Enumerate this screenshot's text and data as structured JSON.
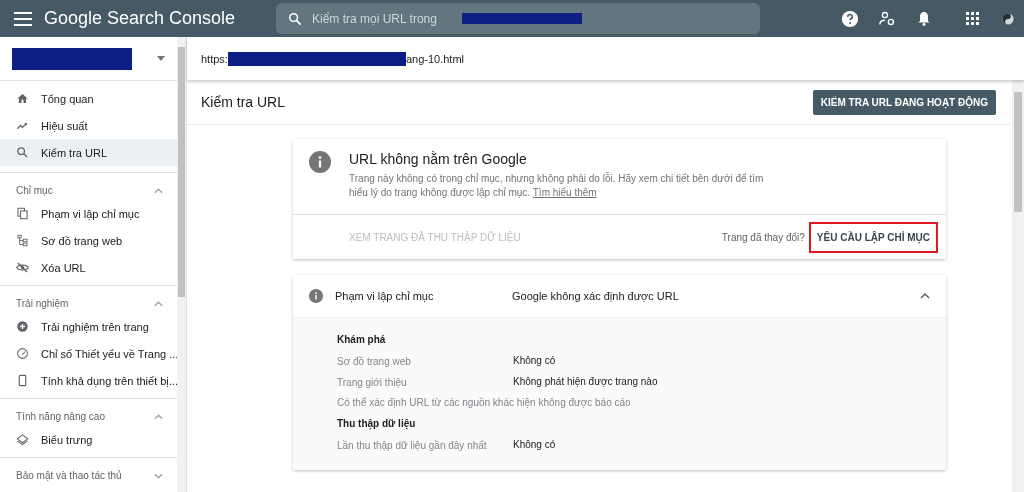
{
  "topbar": {
    "app_title": "Google Search Console",
    "search": {
      "placeholder": "Kiểm tra mọi URL trong"
    }
  },
  "url_bar": {
    "prefix": "https:",
    "suffix": "ang-10.html"
  },
  "sidebar": {
    "sections": [
      {
        "items": [
          {
            "label": "Tổng quan",
            "selected": false
          },
          {
            "label": "Hiệu suất",
            "selected": false
          },
          {
            "label": "Kiểm tra URL",
            "selected": true
          }
        ]
      },
      {
        "title": "Chỉ mục",
        "expanded": true,
        "items": [
          {
            "label": "Phạm vi lập chỉ mục",
            "selected": false
          },
          {
            "label": "Sơ đồ trang web",
            "selected": false
          },
          {
            "label": "Xóa URL",
            "selected": false
          }
        ]
      },
      {
        "title": "Trải nghiệm",
        "expanded": true,
        "items": [
          {
            "label": "Trải nghiệm trên trang",
            "selected": false
          },
          {
            "label": "Chỉ số Thiết yếu về Trang ...",
            "selected": false
          },
          {
            "label": "Tính khả dụng trên thiết bị...",
            "selected": false
          }
        ]
      },
      {
        "title": "Tính năng nâng cao",
        "expanded": true,
        "items": [
          {
            "label": "Biểu trưng",
            "selected": false
          }
        ]
      },
      {
        "title": "Bảo mật và thao tác thủ",
        "expanded": false
      }
    ]
  },
  "page": {
    "title": "Kiểm tra URL",
    "live_test_button": "KIỂM TRA URL ĐANG HOẠT ĐỘNG"
  },
  "status_card": {
    "title": "URL không nằm trên Google",
    "description": "Trang này không có trong chỉ mục, nhưng không phải do lỗi. Hãy xem chi tiết bên dưới để tìm hiểu lý do trang không được lập chỉ mục.",
    "link": "Tìm hiểu thêm",
    "view_crawled_button": {
      "label": "XEM TRANG ĐÃ THU THẬP DỮ LIỆU",
      "disabled": true
    },
    "changed_prompt": "Trang đã thay đổi?",
    "request_button": {
      "label": "YÊU CẦU LẬP CHỈ MỤC",
      "highlighted": true
    }
  },
  "coverage_card": {
    "title": "Phạm vi lập chỉ mục",
    "status": "Google không xác định được URL",
    "expanded": true,
    "groups": [
      {
        "heading": "Khám phá",
        "rows": [
          {
            "kind": "pair",
            "label": "Sơ đồ trang web",
            "value": "Không có"
          },
          {
            "kind": "pair",
            "label": "Trang giới thiệu",
            "value": "Không phát hiện được trang nào"
          },
          {
            "kind": "note",
            "label": "Có thể xác định URL từ các nguồn khác hiện không được báo cáo"
          }
        ]
      },
      {
        "heading": "Thu thập dữ liệu",
        "rows": [
          {
            "kind": "pair",
            "label": "Lần thu thập dữ liệu gần đây nhất",
            "value": "Không có"
          }
        ]
      }
    ]
  }
}
